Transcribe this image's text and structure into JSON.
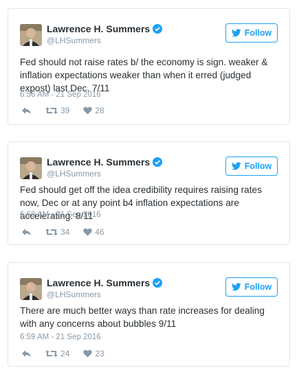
{
  "follow_label": "Follow",
  "colors": {
    "accent": "#1da1f2",
    "meta": "#8899a6",
    "text": "#292f33",
    "border": "#e1e8ed"
  },
  "icons": {
    "bird": "twitter-bird-icon",
    "verified": "verified-badge-icon",
    "reply": "reply-icon",
    "retweet": "retweet-icon",
    "like": "heart-icon"
  },
  "tweets": [
    {
      "name": "Lawrence H. Summers",
      "handle": "@LHSummers",
      "text": "Fed should not raise rates b/ the economy is sign. weaker & inflation expectations weaker than when it erred (judged expost) last Dec. 7/11",
      "timestamp": "6:56 AM - 21 Sep 2016",
      "retweets": "39",
      "likes": "28"
    },
    {
      "name": "Lawrence H. Summers",
      "handle": "@LHSummers",
      "text": "Fed should get off the idea credibility requires raising rates now, Dec or at any point b4 inflation expectations are accelerating. 8/11",
      "timestamp": "6:58 AM - 21 Sep 2016",
      "retweets": "34",
      "likes": "46"
    },
    {
      "name": "Lawrence H. Summers",
      "handle": "@LHSummers",
      "text": "There are much better ways than rate increases for dealing with any concerns about bubbles 9/11",
      "timestamp": "6:59 AM - 21 Sep 2016",
      "retweets": "24",
      "likes": "23"
    }
  ]
}
